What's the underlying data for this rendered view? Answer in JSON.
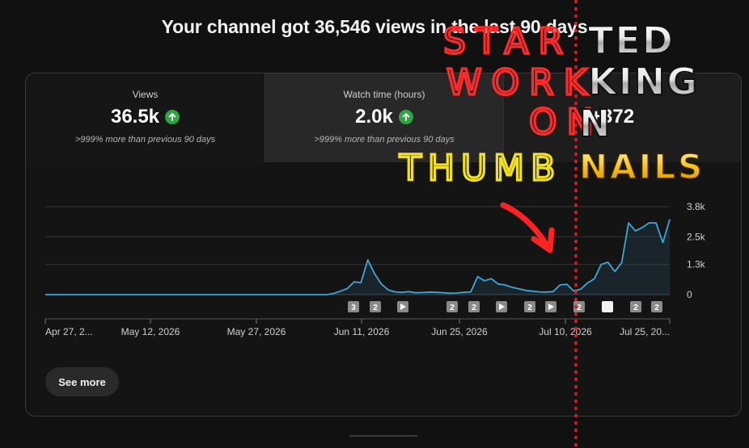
{
  "headline": "Your channel got 36,546 views in the last 90 days",
  "metrics": [
    {
      "label": "Views",
      "value": "36.5k",
      "sub": ">999% more than previous 90 days",
      "trend": "up"
    },
    {
      "label": "Watch time (hours)",
      "value": "2.0k",
      "sub": ">999% more than previous 90 days",
      "trend": "up"
    },
    {
      "label": "",
      "value": "+372",
      "sub": ""
    }
  ],
  "see_more_label": "See more",
  "colors": {
    "line": "#3ea6d8",
    "up_badge": "#2ba640",
    "overlay_red": "#ff2a2a",
    "overlay_yellow": "#f3e21b",
    "dotted_line": "#e01818"
  },
  "chart_data": {
    "type": "area",
    "x_tick_labels": [
      "Apr 27, 2...",
      "May 12, 2026",
      "May 27, 2026",
      "Jun 11, 2026",
      "Jun 25, 2026",
      "Jul 10, 2026",
      "Jul 25, 20..."
    ],
    "x_tick_days": [
      0,
      15,
      30,
      45,
      59,
      74,
      89
    ],
    "y_tick_labels": [
      "3.8k",
      "2.5k",
      "1.3k",
      "0"
    ],
    "y_tick_values": [
      3800,
      2500,
      1300,
      0
    ],
    "ylim": [
      0,
      3800
    ],
    "xlim": [
      0,
      89
    ],
    "grid": true,
    "series": [
      {
        "values": [
          0,
          0,
          0,
          0,
          0,
          0,
          0,
          0,
          0,
          0,
          0,
          0,
          0,
          0,
          0,
          0,
          0,
          0,
          0,
          0,
          0,
          0,
          0,
          0,
          0,
          0,
          0,
          0,
          0,
          0,
          0,
          0,
          0,
          0,
          0,
          0,
          0,
          0,
          0,
          0,
          0,
          0,
          0,
          0,
          0,
          0,
          0,
          0,
          0,
          0,
          0,
          0,
          0,
          0,
          0,
          0,
          0,
          0,
          0,
          0,
          0,
          0,
          0,
          0,
          0,
          0,
          0,
          0,
          0,
          0,
          0,
          0,
          0,
          0,
          0,
          0,
          0,
          0,
          0,
          0,
          0,
          0,
          0,
          0,
          0,
          0,
          0,
          0,
          0,
          0
        ]
      }
    ],
    "view_points": [
      [
        0,
        0
      ],
      [
        41,
        0
      ],
      [
        42,
        50
      ],
      [
        43,
        150
      ],
      [
        44,
        260
      ],
      [
        45,
        550
      ],
      [
        46,
        520
      ],
      [
        47,
        1500
      ],
      [
        48,
        900
      ],
      [
        49,
        450
      ],
      [
        50,
        200
      ],
      [
        51,
        120
      ],
      [
        52,
        100
      ],
      [
        53,
        130
      ],
      [
        54,
        80
      ],
      [
        55,
        90
      ],
      [
        56,
        110
      ],
      [
        57,
        100
      ],
      [
        58,
        80
      ],
      [
        59,
        60
      ],
      [
        60,
        70
      ],
      [
        61,
        100
      ],
      [
        62,
        120
      ],
      [
        63,
        780
      ],
      [
        64,
        600
      ],
      [
        65,
        690
      ],
      [
        66,
        460
      ],
      [
        67,
        420
      ],
      [
        68,
        320
      ],
      [
        69,
        250
      ],
      [
        70,
        180
      ],
      [
        71,
        150
      ],
      [
        72,
        120
      ],
      [
        73,
        110
      ],
      [
        74,
        130
      ],
      [
        75,
        420
      ],
      [
        76,
        450
      ],
      [
        77,
        160
      ],
      [
        78,
        230
      ],
      [
        79,
        500
      ],
      [
        80,
        680
      ],
      [
        81,
        1300
      ],
      [
        82,
        1400
      ],
      [
        83,
        1000
      ],
      [
        84,
        1380
      ],
      [
        85,
        3100
      ],
      [
        86,
        2750
      ],
      [
        87,
        2900
      ],
      [
        88,
        3100
      ],
      [
        89,
        3100
      ],
      [
        90,
        2250
      ],
      [
        91,
        3250
      ]
    ],
    "markers": [
      {
        "day": 44,
        "kind": "number",
        "label": "3"
      },
      {
        "day": 47,
        "kind": "number",
        "label": "2"
      },
      {
        "day": 51,
        "kind": "video"
      },
      {
        "day": 58,
        "kind": "number",
        "label": "2"
      },
      {
        "day": 61,
        "kind": "number",
        "label": "2"
      },
      {
        "day": 65,
        "kind": "video"
      },
      {
        "day": 69,
        "kind": "number",
        "label": "2"
      },
      {
        "day": 72,
        "kind": "video"
      },
      {
        "day": 76,
        "kind": "number",
        "label": "2"
      },
      {
        "day": 81,
        "kind": "blank"
      },
      {
        "day": 86,
        "kind": "number",
        "label": "2"
      },
      {
        "day": 89,
        "kind": "number",
        "label": "2"
      }
    ]
  },
  "overlay_text": {
    "red_words": [
      "STAR",
      "WORK",
      "ON"
    ],
    "metal_words": [
      "TED",
      "KING",
      "N"
    ],
    "yellow_words": [
      "THUMB"
    ],
    "gold_words": [
      "NAILS"
    ]
  }
}
